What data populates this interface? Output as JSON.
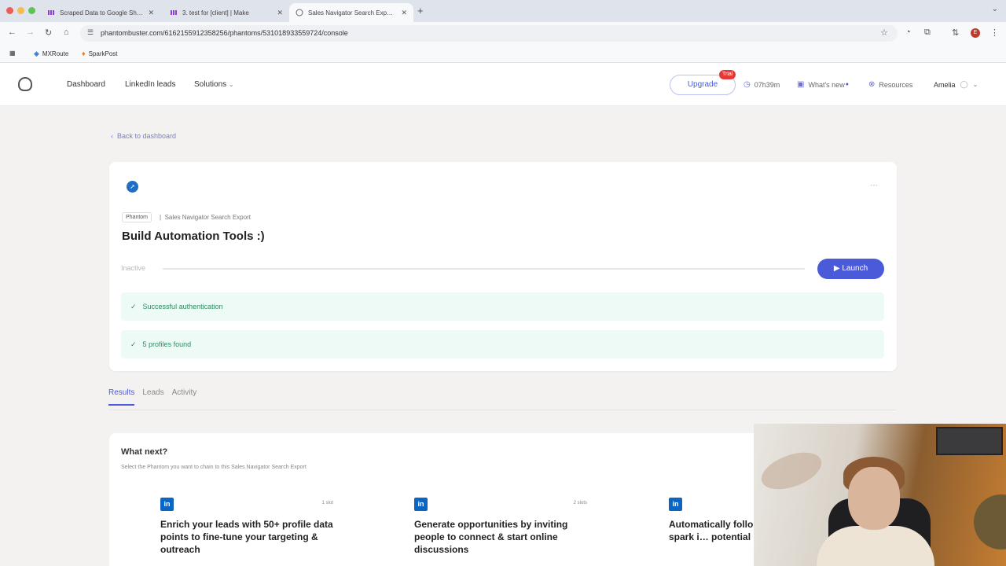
{
  "browser": {
    "tabs": [
      {
        "title": "Scraped Data to Google Sh…",
        "active": false
      },
      {
        "title": "3. test for [client] | Make",
        "active": false
      },
      {
        "title": "Sales Navigator Search Exp…",
        "active": true
      }
    ],
    "url": "phantombuster.com/6162155912358256/phantoms/531018933559724/console",
    "bookmarks": [
      "MXRoute",
      "SparkPost"
    ],
    "profile_initial": "E"
  },
  "header": {
    "nav": [
      "Dashboard",
      "LinkedIn leads",
      "Solutions"
    ],
    "upgrade_label": "Upgrade",
    "trial_badge": "Trial",
    "time_left": "07h39m",
    "whats_new": "What's new",
    "resources": "Resources",
    "user_name": "Amelia"
  },
  "page": {
    "back_label": "Back to dashboard",
    "phantom_tag": "Phantom",
    "phantom_type": "Sales Navigator Search Export",
    "title": "Build Automation Tools :)",
    "status": "Inactive",
    "launch_label": "Launch",
    "checks": [
      "Successful authentication",
      "5 profiles found"
    ],
    "tabs": [
      "Results",
      "Leads",
      "Activity"
    ],
    "active_tab": "Results"
  },
  "next": {
    "title": "What next?",
    "subtitle": "Select the Phantom you want to chain to this Sales Navigator Search Export",
    "suggestions": [
      {
        "slots": "1 slot",
        "text": "Enrich your leads with 50+ profile data points to fine-tune your targeting & outreach"
      },
      {
        "slots": "2 slots",
        "text": "Generate opportunities by inviting people to connect & start online discussions"
      },
      {
        "slots": "",
        "text": "Automatically follo… Linkedin to spark i… potential leads"
      }
    ]
  },
  "colors": {
    "accent": "#4a5ad9",
    "success_bg": "#eefaf5",
    "success_text": "#2e8a63",
    "trial_red": "#e53935",
    "linkedin": "#0a66c2"
  }
}
